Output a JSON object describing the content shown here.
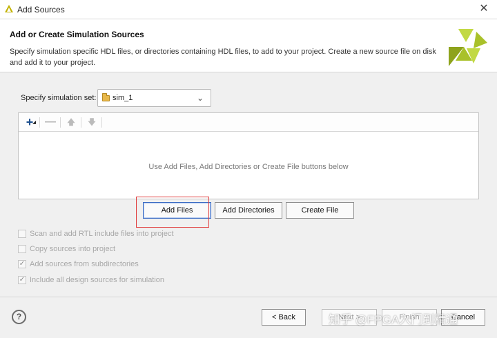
{
  "window": {
    "title": "Add Sources"
  },
  "header": {
    "title": "Add or Create Simulation Sources",
    "description": "Specify simulation specific HDL files, or directories containing HDL files, to add to your project. Create a new source file on disk and add it to your project."
  },
  "simulation_set": {
    "label": "Specify simulation set:",
    "value": "sim_1"
  },
  "file_list": {
    "empty_message": "Use Add Files, Add Directories or Create File buttons below"
  },
  "buttons": {
    "add_files": "Add Files",
    "add_directories": "Add Directories",
    "create_file": "Create File"
  },
  "options": [
    {
      "label": "Scan and add RTL include files into project",
      "checked": false
    },
    {
      "label": "Copy sources into project",
      "checked": false
    },
    {
      "label": "Add sources from subdirectories",
      "checked": true
    },
    {
      "label": "Include all design sources for simulation",
      "checked": true
    }
  ],
  "footer": {
    "help": "?",
    "back": "< Back",
    "next": "Next >",
    "finish": "Finish",
    "cancel": "Cancel"
  },
  "watermark": "知乎 @FPGA入门到精通",
  "colors": {
    "logo_light": "#c2d944",
    "logo_dark": "#8ea31c",
    "title_icon": "#c2b200",
    "focus_border": "#3b6cc4",
    "highlight_box": "#e03a3a"
  },
  "icons": {
    "add": "plus-icon",
    "remove": "minus-icon",
    "move_up": "arrow-up-icon",
    "move_down": "arrow-down-icon",
    "folder": "folder-icon",
    "dropdown": "chevron-down-icon",
    "close": "close-icon"
  }
}
